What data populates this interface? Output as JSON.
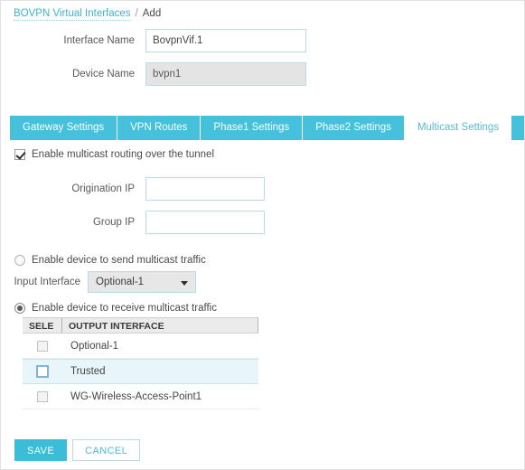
{
  "breadcrumb": {
    "link": "BOVPN Virtual Interfaces",
    "separator": "/",
    "current": "Add"
  },
  "form": {
    "interface_name": {
      "label": "Interface Name",
      "value": "BovpnVif.1",
      "placeholder": ""
    },
    "device_name": {
      "label": "Device Name",
      "value": "bvpn1",
      "placeholder": ""
    }
  },
  "tabs": [
    {
      "label": "Gateway Settings",
      "active": false
    },
    {
      "label": "VPN Routes",
      "active": false
    },
    {
      "label": "Phase1 Settings",
      "active": false
    },
    {
      "label": "Phase2 Settings",
      "active": false
    },
    {
      "label": "Multicast Settings",
      "active": true
    }
  ],
  "multicast": {
    "enable_checkbox_label": "Enable multicast routing over the tunnel",
    "enable_checked": true,
    "origination_ip": {
      "label": "Origination IP",
      "value": "",
      "placeholder": ""
    },
    "group_ip": {
      "label": "Group IP",
      "value": "",
      "placeholder": ""
    },
    "send_radio_label": "Enable device to send multicast traffic",
    "send_radio_selected": false,
    "input_interface": {
      "label": "Input Interface",
      "selected": "Optional-1",
      "options": [
        "Optional-1"
      ]
    },
    "receive_radio_label": "Enable device to receive multicast traffic",
    "receive_radio_selected": true,
    "output_table": {
      "columns": [
        "SELE",
        "OUTPUT INTERFACE"
      ],
      "rows": [
        {
          "interface": "Optional-1",
          "checked": false,
          "highlighted": false,
          "focused": false
        },
        {
          "interface": "Trusted",
          "checked": false,
          "highlighted": true,
          "focused": true
        },
        {
          "interface": "WG-Wireless-Access-Point1",
          "checked": false,
          "highlighted": false,
          "focused": false
        }
      ]
    }
  },
  "buttons": {
    "save": "SAVE",
    "cancel": "CANCEL"
  },
  "colors": {
    "accent_teal": "#45c1db",
    "save_button": "#3bbdd8",
    "link": "#3bb4d0",
    "row_highlight": "#e8f6fb"
  }
}
